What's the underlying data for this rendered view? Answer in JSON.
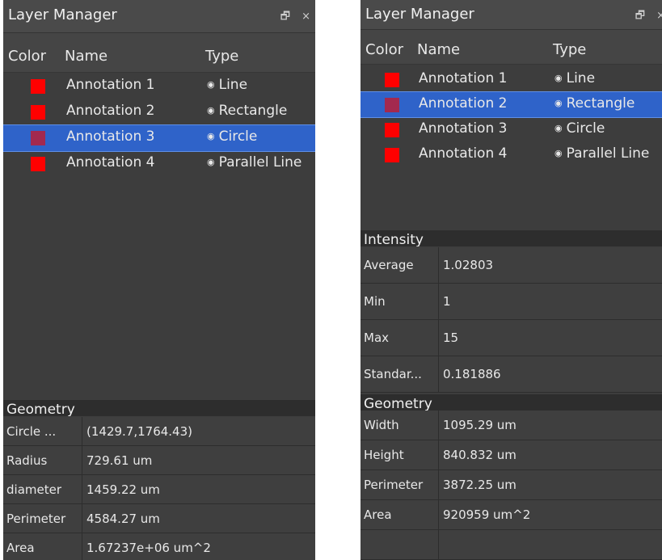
{
  "colors": {
    "panel_bg": "#3d3d3d",
    "selection": "#2f63c9",
    "swatch_red": "#ff0000",
    "swatch_selected": "#a3294f"
  },
  "left": {
    "title": "Layer Manager",
    "window_buttons": {
      "float": "🗗",
      "close": "×"
    },
    "columns": {
      "color": "Color",
      "name": "Name",
      "type": "Type"
    },
    "layers": [
      {
        "name": "Annotation 1",
        "type": "Line",
        "eye": "◉",
        "selected": false
      },
      {
        "name": "Annotation 2",
        "type": "Rectangle",
        "eye": "◉",
        "selected": false
      },
      {
        "name": "Annotation 3",
        "type": "Circle",
        "eye": "◉",
        "selected": true
      },
      {
        "name": "Annotation 4",
        "type": "Parallel Line",
        "eye": "◉",
        "selected": false
      }
    ],
    "geometry": {
      "header": "Geometry",
      "rows": [
        {
          "key": "Circle ...",
          "value": "(1429.7,1764.43)"
        },
        {
          "key": "Radius",
          "value": "729.61 um"
        },
        {
          "key": "diameter",
          "value": "1459.22 um"
        },
        {
          "key": "Perimeter",
          "value": "4584.27 um"
        },
        {
          "key": "Area",
          "value": "1.67237e+06 um^2"
        }
      ]
    }
  },
  "right": {
    "title": "Layer Manager",
    "window_buttons": {
      "float": "🗗",
      "close": "×"
    },
    "columns": {
      "color": "Color",
      "name": "Name",
      "type": "Type"
    },
    "layers": [
      {
        "name": "Annotation 1",
        "type": "Line",
        "eye": "◉",
        "selected": false
      },
      {
        "name": "Annotation 2",
        "type": "Rectangle",
        "eye": "◉",
        "selected": true
      },
      {
        "name": "Annotation 3",
        "type": "Circle",
        "eye": "◉",
        "selected": false
      },
      {
        "name": "Annotation 4",
        "type": "Parallel Line",
        "eye": "◉",
        "selected": false
      }
    ],
    "intensity": {
      "header": "Intensity",
      "rows": [
        {
          "key": "Average",
          "value": "1.02803"
        },
        {
          "key": "Min",
          "value": "1"
        },
        {
          "key": "Max",
          "value": "15"
        },
        {
          "key": "Standar...",
          "value": "0.181886"
        }
      ]
    },
    "geometry": {
      "header": "Geometry",
      "rows": [
        {
          "key": "Width",
          "value": "1095.29 um"
        },
        {
          "key": "Height",
          "value": "840.832 um"
        },
        {
          "key": "Perimeter",
          "value": "3872.25 um"
        },
        {
          "key": "Area",
          "value": "920959 um^2"
        },
        {
          "key": "",
          "value": ""
        }
      ]
    }
  }
}
